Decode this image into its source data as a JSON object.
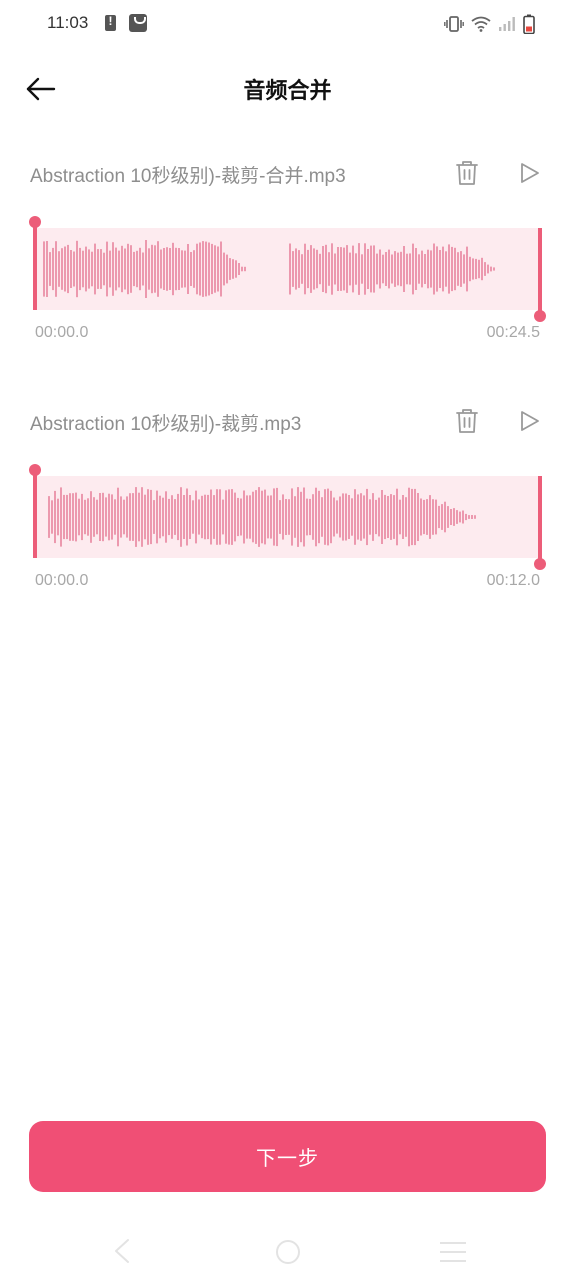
{
  "status_bar": {
    "time": "11:03",
    "icons": [
      "alert-icon",
      "shopping-bag-icon",
      "vibrate-icon",
      "wifi-icon",
      "signal-icon",
      "battery-icon"
    ]
  },
  "header": {
    "title": "音频合并",
    "back_icon": "arrow-left-icon"
  },
  "colors": {
    "accent": "#f04f75",
    "waveform": "#e06283",
    "wave_background": "#fdebef",
    "handle": "#ec5d79",
    "muted_text": "#8e8e8e"
  },
  "tracks": [
    {
      "name": "Abstraction 10秒级别)-裁剪-合并.mp3",
      "start_time": "00:00.0",
      "end_time": "00:24.5"
    },
    {
      "name": "Abstraction 10秒级别)-裁剪.mp3",
      "start_time": "00:00.0",
      "end_time": "00:12.0"
    }
  ],
  "actions": {
    "next_label": "下一步"
  },
  "nav_bar": {
    "icons": [
      "nav-back-icon",
      "nav-home-icon",
      "nav-menu-icon"
    ]
  }
}
